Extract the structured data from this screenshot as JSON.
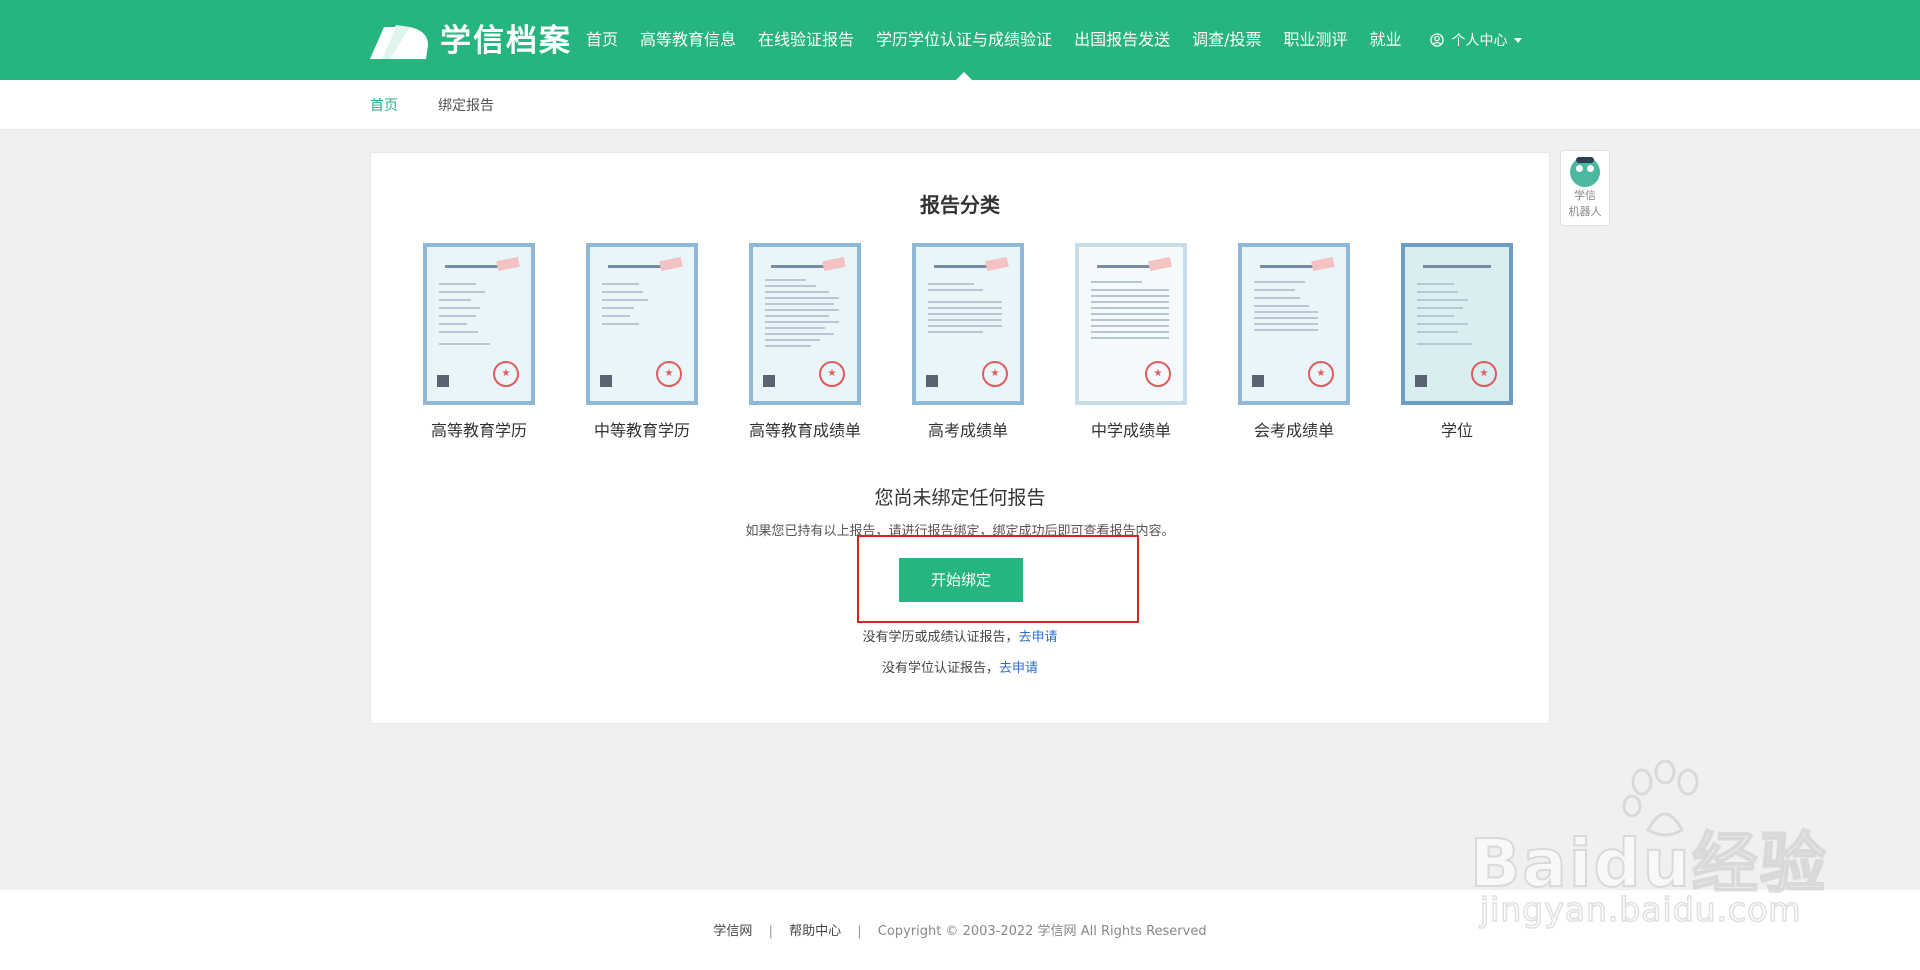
{
  "header": {
    "logo_text": "学信档案",
    "nav": [
      {
        "label": "首页"
      },
      {
        "label": "高等教育信息"
      },
      {
        "label": "在线验证报告"
      },
      {
        "label": "学历学位认证与成绩验证"
      },
      {
        "label": "出国报告发送"
      },
      {
        "label": "调查/投票"
      },
      {
        "label": "职业测评"
      },
      {
        "label": "就业"
      }
    ],
    "user_label": "个人中心",
    "colors": {
      "brand": "#26b47f"
    }
  },
  "breadcrumb": {
    "home": "首页",
    "current": "绑定报告"
  },
  "main": {
    "title": "报告分类",
    "reports": [
      {
        "label": "高等教育学历"
      },
      {
        "label": "中等教育学历"
      },
      {
        "label": "高等教育成绩单"
      },
      {
        "label": "高考成绩单"
      },
      {
        "label": "中学成绩单"
      },
      {
        "label": "会考成绩单"
      },
      {
        "label": "学位"
      }
    ],
    "empty_title": "您尚未绑定任何报告",
    "empty_desc": "如果您已持有以上报告，请进行报告绑定，绑定成功后即可查看报告内容。",
    "start_button": "开始绑定",
    "line1_text": "没有学历或成绩认证报告，",
    "line1_link": "去申请",
    "line2_text": "没有学位认证报告，",
    "line2_link": "去申请"
  },
  "robot": {
    "line1": "学信",
    "line2": "机器人"
  },
  "footer": {
    "link1": "学信网",
    "sep": "|",
    "link2": "帮助中心",
    "copyright": "Copyright © 2003-2022 学信网 All Rights Reserved"
  },
  "watermark": {
    "brand": "Baidu经验",
    "url": "jingyan.baidu.com"
  }
}
